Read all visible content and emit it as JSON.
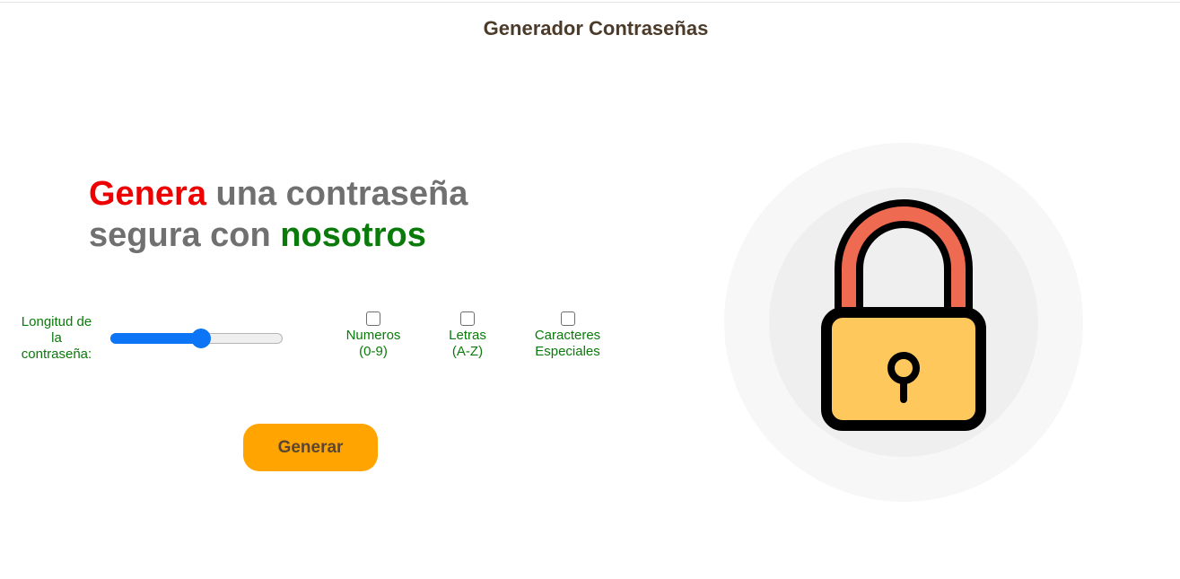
{
  "header": {
    "title": "Generador Contraseñas"
  },
  "hero": {
    "word_red": "Genera",
    "text_middle": " una contraseña segura con ",
    "word_green": "nosotros"
  },
  "length": {
    "label": "Longitud de la contraseña:",
    "value_fraction": 0.53
  },
  "options": [
    {
      "line1": "Numeros",
      "line2": "(0-9)",
      "checked": false
    },
    {
      "line1": "Letras",
      "line2": "(A-Z)",
      "checked": false
    },
    {
      "line1": "Caracteres",
      "line2": "Especiales",
      "checked": false
    }
  ],
  "button": {
    "label": "Generar"
  },
  "illustration": {
    "icon": "padlock-icon",
    "colors": {
      "outer_circle": "#f7f7f7",
      "inner_circle": "#f0eff0",
      "shackle": "#ee6a50",
      "body": "#ffc85c",
      "outline": "#000000"
    }
  },
  "colors": {
    "accent_red": "#ee0000",
    "accent_green": "#0a7a0a",
    "slider_blue": "#0b75f5",
    "button_orange": "#ffa400"
  }
}
